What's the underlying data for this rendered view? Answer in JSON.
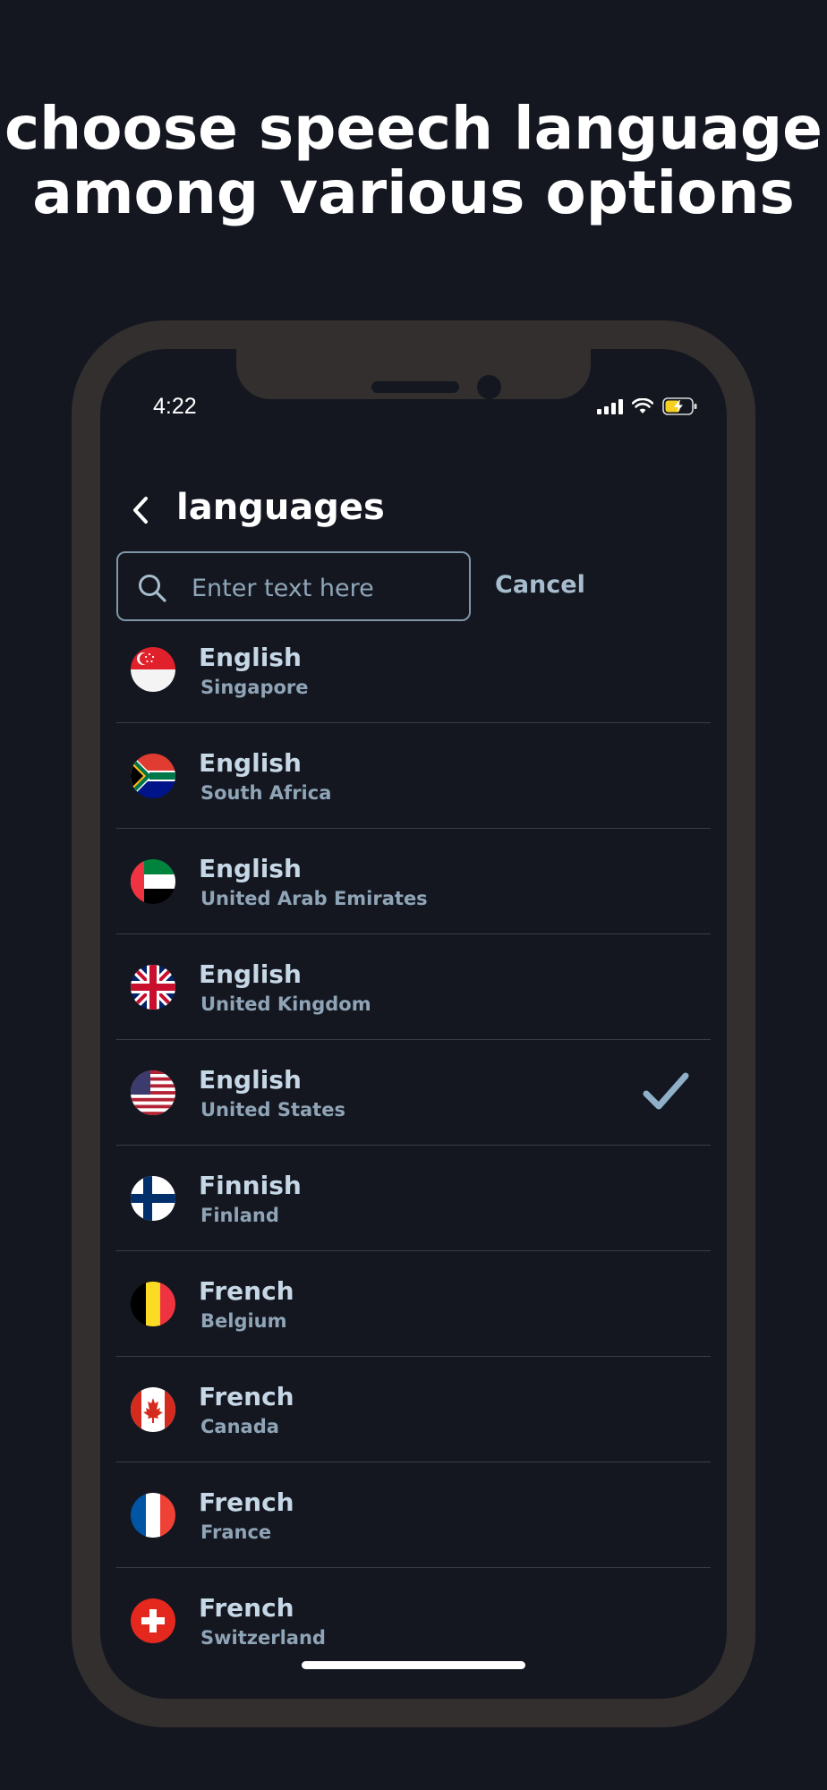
{
  "headline": {
    "line1": "choose speech language",
    "line2": "among various options"
  },
  "status_bar": {
    "time": "4:22",
    "icons": [
      "signal-icon",
      "wifi-icon",
      "battery-charging-icon"
    ]
  },
  "nav": {
    "title": "languages",
    "back_icon": "chevron-left-icon"
  },
  "search": {
    "placeholder": "Enter text here",
    "value": "",
    "cancel_label": "Cancel"
  },
  "colors": {
    "background": "#141720",
    "phone_frame": "#322f2e",
    "text_primary": "#c6d7e6",
    "text_secondary": "#8fa4b6",
    "accent_check": "#8fb0c8"
  },
  "languages": [
    {
      "language": "English",
      "region": "Singapore",
      "flag": "singapore-flag-icon",
      "selected": false
    },
    {
      "language": "English",
      "region": "South Africa",
      "flag": "south-africa-flag-icon",
      "selected": false
    },
    {
      "language": "English",
      "region": "United Arab Emirates",
      "flag": "uae-flag-icon",
      "selected": false
    },
    {
      "language": "English",
      "region": "United Kingdom",
      "flag": "uk-flag-icon",
      "selected": false
    },
    {
      "language": "English",
      "region": "United States",
      "flag": "us-flag-icon",
      "selected": true
    },
    {
      "language": "Finnish",
      "region": "Finland",
      "flag": "finland-flag-icon",
      "selected": false
    },
    {
      "language": "French",
      "region": "Belgium",
      "flag": "belgium-flag-icon",
      "selected": false
    },
    {
      "language": "French",
      "region": "Canada",
      "flag": "canada-flag-icon",
      "selected": false
    },
    {
      "language": "French",
      "region": "France",
      "flag": "france-flag-icon",
      "selected": false
    },
    {
      "language": "French",
      "region": "Switzerland",
      "flag": "switzerland-flag-icon",
      "selected": false
    }
  ]
}
